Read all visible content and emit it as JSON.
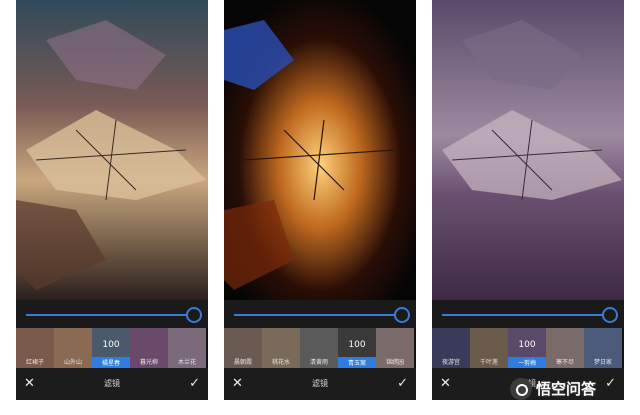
{
  "panels": [
    {
      "filters": [
        "红裙子",
        "山外山",
        "橘星春",
        "暮光柳",
        "木兰花"
      ],
      "selected_index": 2,
      "value": "100",
      "title": "滤镜",
      "slider_level": 1.0,
      "tint": "#6b4a3e"
    },
    {
      "filters": [
        "晨朝霞",
        "桃花水",
        "清黄雨",
        "青玉案",
        "锦绣园"
      ],
      "selected_index": 3,
      "value": "100",
      "title": "滤镜",
      "slider_level": 1.0,
      "tint": "#c87a2a"
    },
    {
      "filters": [
        "夜游宫",
        "千叶莲",
        "一剪梅",
        "寒不尽",
        "梦日家"
      ],
      "selected_index": 2,
      "value": "100",
      "title": "滤镜",
      "slider_level": 1.0,
      "tint": "#5a3d63"
    }
  ],
  "watermark": {
    "text": "悟空问答",
    "icon": "wukong-logo-icon"
  },
  "colors": {
    "accent": "#2f7de1",
    "panel_bg": "#1c1c1c"
  }
}
